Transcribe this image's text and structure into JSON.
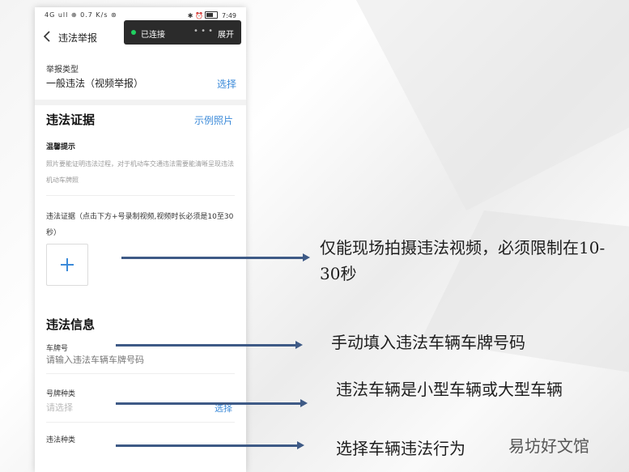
{
  "status_bar": {
    "left": "4G ull ⊕ 0.7 K/s ⊛",
    "right_icons": "✱ ⏰",
    "time": "7:49"
  },
  "nav": {
    "title": "违法举报"
  },
  "toast": {
    "status": "已连接",
    "dots": "• • •",
    "expand": "展开"
  },
  "report_type": {
    "label": "举报类型",
    "value": "一般违法（视频举报）",
    "select": "选择"
  },
  "evidence": {
    "title": "违法证据",
    "sample_link": "示例照片",
    "tip_title": "温馨提示",
    "tip_text": "照片要能证明违法过程，对于机动车交通违法需要能清晰呈现违法机动车牌照",
    "instruction": "违法证据（点击下方+号录制视频,视频时长必须是10至30秒）"
  },
  "violation_info": {
    "title": "违法信息",
    "plate_label": "车牌号",
    "plate_placeholder": "请输入违法车辆车牌号码",
    "plate_type_label": "号牌种类",
    "plate_type_value": "请选择",
    "plate_type_select": "选择",
    "violation_type_label": "违法种类"
  },
  "annotations": {
    "a1": "仅能现场拍摄违法视频，必须限制在10-30秒",
    "a2": "手动填入违法车辆车牌号码",
    "a3": "违法车辆是小型车辆或大型车辆",
    "a4": "选择车辆违法行为"
  },
  "watermark": "易坊好文馆",
  "colors": {
    "accent": "#3b8ad9",
    "arrow": "#3e5a86",
    "toast_bg": "#2b2b2b",
    "connected_dot": "#20d060"
  }
}
